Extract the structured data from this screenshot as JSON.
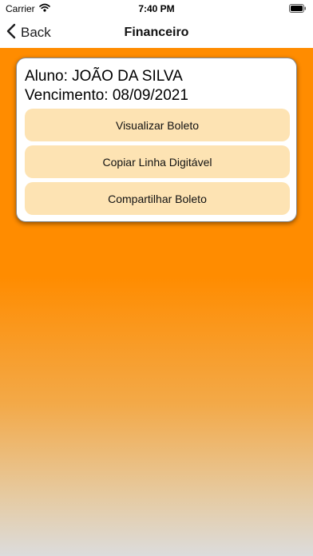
{
  "status_bar": {
    "carrier": "Carrier",
    "time": "7:40 PM",
    "icons": [
      "wifi-icon",
      "battery-icon"
    ]
  },
  "nav": {
    "back_label": "Back",
    "title": "Financeiro",
    "back_icon": "chevron-left-icon"
  },
  "card": {
    "student_line": "Aluno: JOÃO DA SILVA",
    "due_line": "Vencimento: 08/09/2021",
    "buttons": [
      {
        "label": "Visualizar Boleto"
      },
      {
        "label": "Copiar Linha Digitável"
      },
      {
        "label": "Compartilhar Boleto"
      }
    ]
  },
  "colors": {
    "background_top": "#ff8c00",
    "background_bottom": "#dcdcdc",
    "button_fill": "#fde3b3",
    "card_background": "#ffffff"
  }
}
